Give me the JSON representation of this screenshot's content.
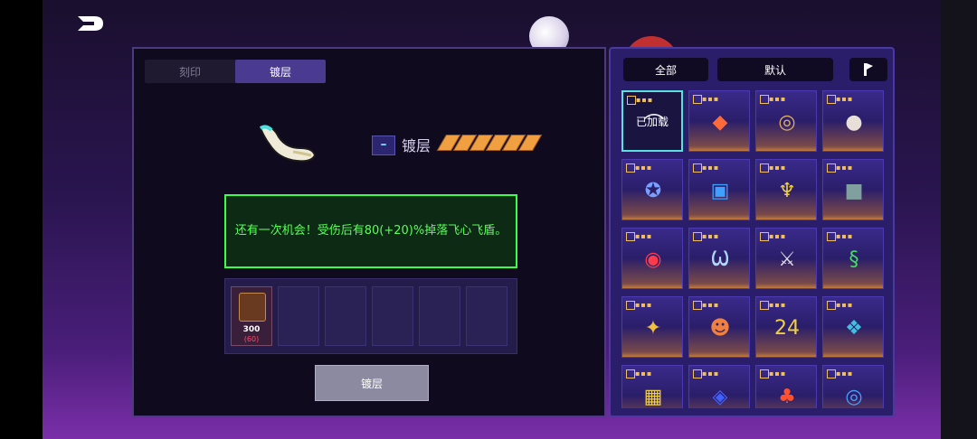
{
  "header": {
    "back_icon": "back-arrow-icon"
  },
  "left_panel": {
    "tabs": [
      {
        "label": "刻印",
        "active": false
      },
      {
        "label": "镀层",
        "active": true
      }
    ],
    "item": {
      "layer_label": "镀层",
      "pips": 6
    },
    "description": "还有一次机会！受伤后有80(+20)%掉落飞心飞盾。",
    "slots": [
      {
        "filled": true,
        "cost": "300",
        "sub": "(60)"
      },
      {
        "filled": false
      },
      {
        "filled": false
      },
      {
        "filled": false
      },
      {
        "filled": false
      },
      {
        "filled": false
      }
    ],
    "confirm_label": "镀层"
  },
  "right_panel": {
    "filter_all": "全部",
    "sort_default": "默认",
    "items": [
      {
        "glyph": "⌒",
        "color": "#f0f0f0",
        "overlay": "已加载",
        "selected": true
      },
      {
        "glyph": "◆",
        "color": "#ff6a3a"
      },
      {
        "glyph": "◎",
        "color": "#e0b060"
      },
      {
        "glyph": "●",
        "color": "#e8e0d8"
      },
      {
        "glyph": "✪",
        "color": "#7aa0ff"
      },
      {
        "glyph": "▣",
        "color": "#40a0ff"
      },
      {
        "glyph": "♆",
        "color": "#f0d040"
      },
      {
        "glyph": "■",
        "color": "#80a0a0"
      },
      {
        "glyph": "◉",
        "color": "#ff3a4a"
      },
      {
        "glyph": "Ѡ",
        "color": "#b0d8ff"
      },
      {
        "glyph": "⚔",
        "color": "#e0e0e0"
      },
      {
        "glyph": "§",
        "color": "#40e060"
      },
      {
        "glyph": "✦",
        "color": "#f0c040"
      },
      {
        "glyph": "☻",
        "color": "#f08040"
      },
      {
        "glyph": "24",
        "color": "#f0d040"
      },
      {
        "glyph": "❖",
        "color": "#40c0e0"
      },
      {
        "glyph": "▦",
        "color": "#f0d040"
      },
      {
        "glyph": "◈",
        "color": "#4060ff"
      },
      {
        "glyph": "♣",
        "color": "#ff5030"
      },
      {
        "glyph": "◎",
        "color": "#4aa0ff"
      }
    ]
  }
}
